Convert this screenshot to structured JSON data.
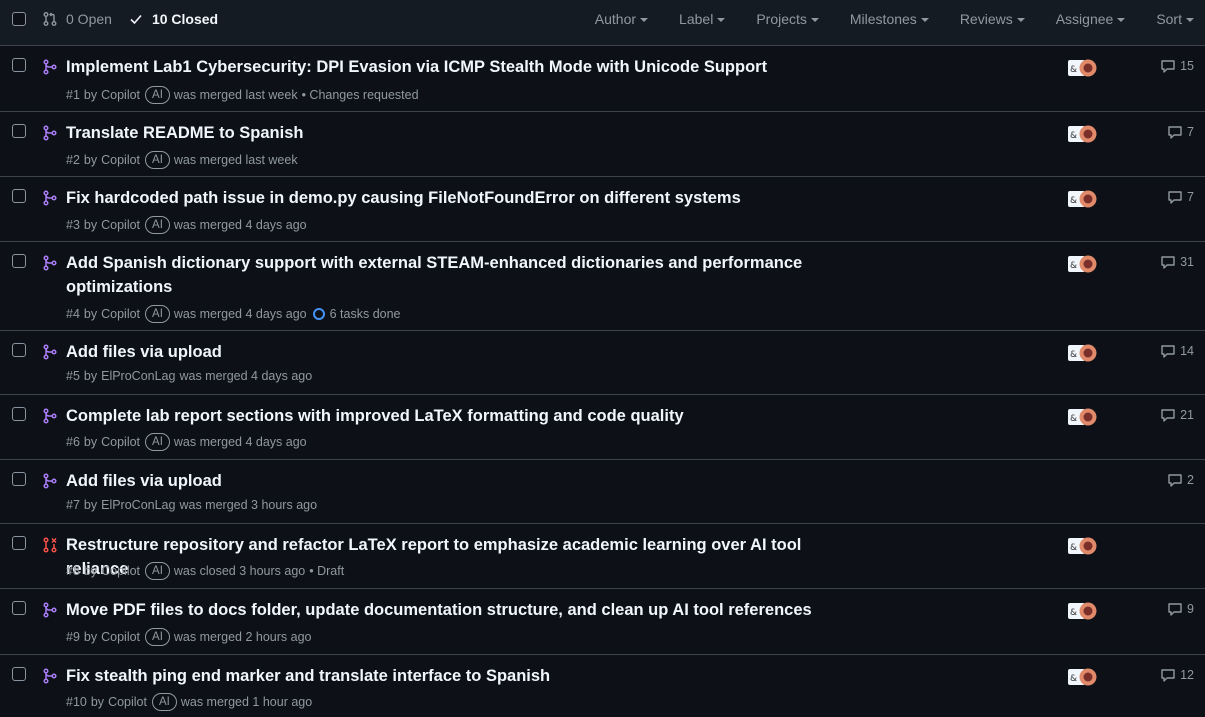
{
  "header": {
    "open_label": "0 Open",
    "closed_label": "10 Closed",
    "filters": [
      "Author",
      "Label",
      "Projects",
      "Milestones",
      "Reviews",
      "Assignee",
      "Sort"
    ]
  },
  "colors": {
    "merged": "#ab7df8",
    "closed": "#f85149",
    "accent": "#4493f8"
  },
  "pulls": [
    {
      "title": "Implement Lab1 Cybersecurity: DPI Evasion via ICMP Stealth Mode with Unicode Support",
      "number": "#1",
      "by": "by",
      "author": "Copilot",
      "ai": "AI",
      "status": "was merged last week",
      "extra": "• Changes requested",
      "comments": "15",
      "state": "merged"
    },
    {
      "title": "Translate README to Spanish",
      "number": "#2",
      "by": "by",
      "author": "Copilot",
      "ai": "AI",
      "status": "was merged last week",
      "extra": "",
      "comments": "7",
      "state": "merged"
    },
    {
      "title": "Fix hardcoded path issue in demo.py causing FileNotFoundError on different systems",
      "number": "#3",
      "by": "by",
      "author": "Copilot",
      "ai": "AI",
      "status": "was merged 4 days ago",
      "extra": "",
      "comments": "7",
      "state": "merged"
    },
    {
      "title": "Add Spanish dictionary support with external STEAM-enhanced dictionaries and performance optimizations",
      "number": "#4",
      "by": "by",
      "author": "Copilot",
      "ai": "AI",
      "status": "was merged 4 days ago",
      "extra": "6 tasks done",
      "comments": "31",
      "state": "merged"
    },
    {
      "title": "Add files via upload",
      "number": "#5",
      "by": "by",
      "author": "ElProConLag",
      "ai": "",
      "status": "was merged 4 days ago",
      "extra": "",
      "comments": "14",
      "state": "merged"
    },
    {
      "title": "Complete lab report sections with improved LaTeX formatting and code quality",
      "number": "#6",
      "by": "by",
      "author": "Copilot",
      "ai": "AI",
      "status": "was merged 4 days ago",
      "extra": "",
      "comments": "21",
      "state": "merged"
    },
    {
      "title": "Add files via upload",
      "number": "#7",
      "by": "by",
      "author": "ElProConLag",
      "ai": "",
      "status": "was merged 3 hours ago",
      "extra": "",
      "comments": "2",
      "state": "merged"
    },
    {
      "title": "Restructure repository and refactor LaTeX report to emphasize academic learning over AI tool reliance",
      "number": "#8",
      "by": "by",
      "author": "Copilot",
      "ai": "AI",
      "status": "was closed 3 hours ago",
      "extra": "• Draft",
      "comments": "",
      "state": "closed"
    },
    {
      "title": "Move PDF files to docs folder, update documentation structure, and clean up AI tool references",
      "number": "#9",
      "by": "by",
      "author": "Copilot",
      "ai": "AI",
      "status": "was merged 2 hours ago",
      "extra": "",
      "comments": "9",
      "state": "merged"
    },
    {
      "title": "Fix stealth ping end marker and translate interface to Spanish",
      "number": "#10",
      "by": "by",
      "author": "Copilot",
      "ai": "AI",
      "status": "was merged 1 hour ago",
      "extra": "",
      "comments": "12",
      "state": "merged"
    }
  ]
}
